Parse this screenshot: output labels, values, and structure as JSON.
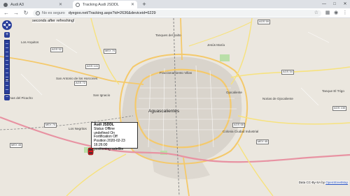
{
  "browser": {
    "tabs": [
      {
        "title": "Audi A3",
        "active": false
      },
      {
        "title": "Tracking Audi JSDDL",
        "active": true
      }
    ],
    "address": {
      "security_label": "No es seguro",
      "url": "dyegoo.net/Tracking.aspx?id=2636&deviceid=6229"
    },
    "window_controls": [
      "—",
      "□",
      "✕"
    ]
  },
  "page": {
    "refresh_text": "seconds after refreshing!",
    "map": {
      "city_label": "Aguascalientes",
      "place_labels": [
        "Los Arquitos",
        "San Antonio de los Horcones",
        "Lomas del Picacho",
        "Los Negritos",
        "San Ignacio",
        "Norias de Ojocaliente",
        "Tanque El Trigo",
        "Colonia Ciudad Industrial",
        "Fraccionamiento Villas",
        "Tanques del Salto",
        "Ojocaliente",
        "Jesús María"
      ],
      "road_shields": [
        "MEX 45",
        "MEX 70",
        "MEX 70",
        "AGS 52",
        "AGS 59",
        "AGS 72",
        "AGS 141",
        "AGS 54",
        "AGS 130",
        "MEX 45",
        "AGS 68"
      ],
      "popup": {
        "lines": [
          "Audi JSDDL",
          "Status Offline",
          "undefined On",
          "Fortification Off",
          "Position 2020-02-23 16:26:00",
          "positioning satellite"
        ]
      },
      "attribution": {
        "prefix": "Data CC-By-SA by",
        "link": "OpenStreetMap"
      }
    }
  },
  "colors": {
    "map_bg": "#ebe7df",
    "major_road": "#f4c96b",
    "primary_road": "#f7e27d",
    "motorway": "#e892a2",
    "railway": "#888888",
    "urban": "#d9d4cc",
    "park": "#b9dfa8",
    "control_blue": "#2a3f9b",
    "marker_red": "#e0161f"
  },
  "icons": {
    "back": "arrow-left-icon",
    "forward": "arrow-right-icon",
    "reload": "reload-icon",
    "info": "info-icon",
    "star": "star-icon",
    "menu": "kebab-menu-icon"
  }
}
